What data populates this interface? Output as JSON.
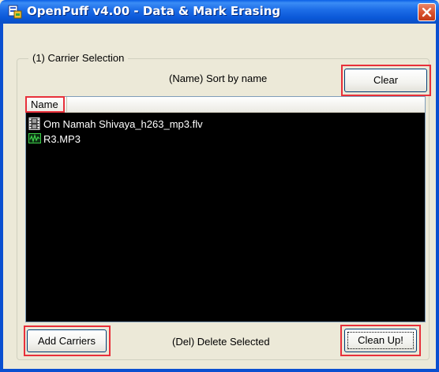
{
  "window": {
    "title": "OpenPuff v4.00 - Data & Mark Erasing"
  },
  "carrier_group": {
    "legend": "(1) Carrier Selection",
    "sort_hint": "(Name) Sort by name",
    "clear_label": "Clear",
    "list_header": "Name",
    "items": [
      {
        "name": "Om Namah Shivaya_h263_mp3.flv",
        "icon": "video-file-icon"
      },
      {
        "name": "R3.MP3",
        "icon": "audio-file-icon"
      }
    ],
    "add_label": "Add Carriers",
    "delete_hint": "(Del) Delete Selected",
    "cleanup_label": "Clean Up!"
  },
  "colors": {
    "title_bar": "#0a58d8",
    "list_bg": "#000000",
    "highlight": "#e8303a",
    "window_bg": "#ece9d8"
  }
}
